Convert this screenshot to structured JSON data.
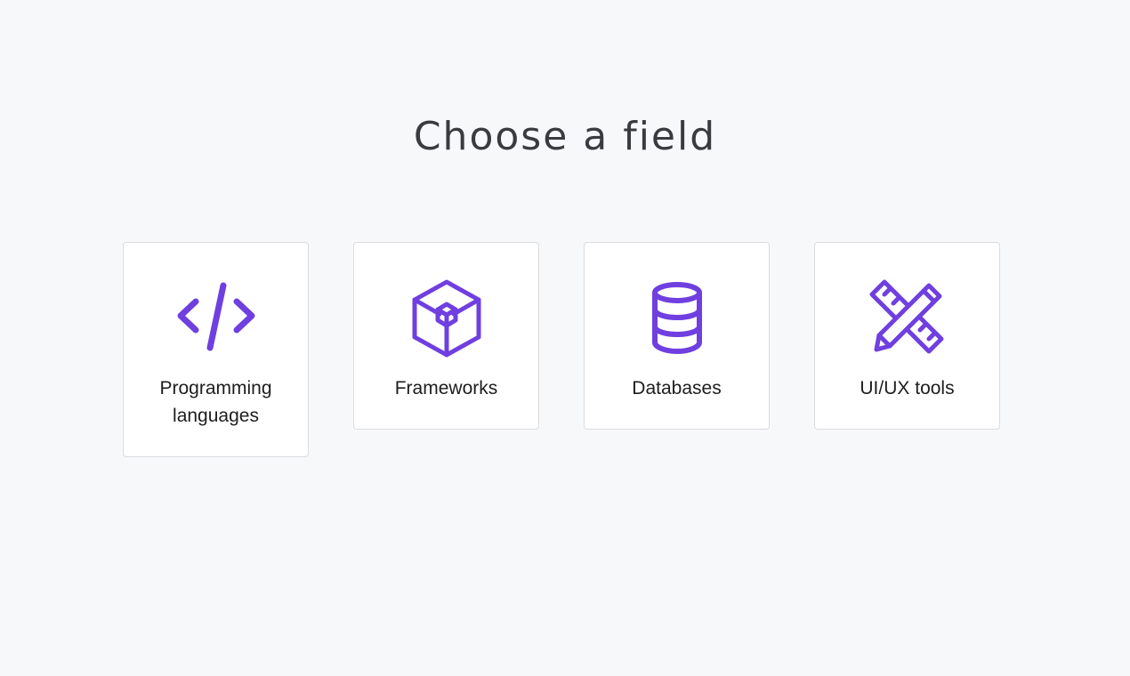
{
  "page": {
    "title": "Choose a field"
  },
  "accent_color": "#6f3fe0",
  "cards": [
    {
      "label": "Programming languages",
      "icon": "code-icon"
    },
    {
      "label": "Frameworks",
      "icon": "cube-icon"
    },
    {
      "label": "Databases",
      "icon": "database-icon"
    },
    {
      "label": "UI/UX tools",
      "icon": "ruler-pencil-icon"
    }
  ]
}
